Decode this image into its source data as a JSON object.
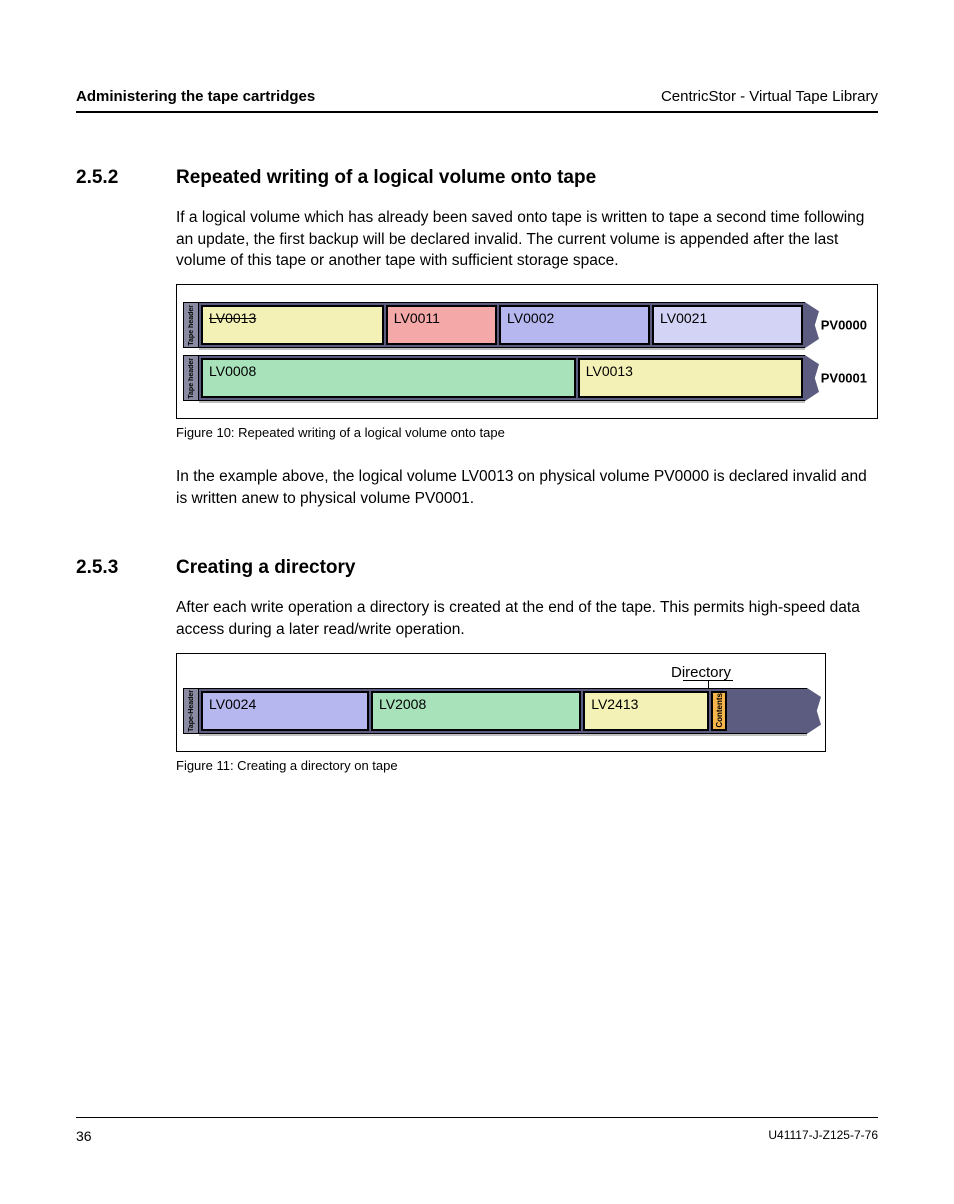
{
  "header": {
    "left": "Administering the tape cartridges",
    "right": "CentricStor - Virtual Tape Library"
  },
  "section252": {
    "num": "2.5.2",
    "title": "Repeated writing of a logical volume onto tape",
    "para1": "If a logical volume which has already been saved onto tape is written to tape a second time following an update, the first backup will be declared invalid. The current volume is appended after the last volume of this tape or another tape with sufficient storage space.",
    "fig": {
      "tape_header_label": "Tape header",
      "rows": [
        {
          "pv": "PV0000",
          "vols": [
            {
              "label": "LV0013",
              "color": "yellow",
              "strike": true,
              "flex": 2.1
            },
            {
              "label": "LV0011",
              "color": "pink",
              "strike": false,
              "flex": 1.2
            },
            {
              "label": "LV0002",
              "color": "blue",
              "strike": false,
              "flex": 1.7
            },
            {
              "label": "LV0021",
              "color": "light",
              "strike": false,
              "flex": 1.7
            }
          ]
        },
        {
          "pv": "PV0001",
          "vols": [
            {
              "label": "LV0008",
              "color": "green",
              "strike": false,
              "flex": 2.4
            },
            {
              "label": "LV0013",
              "color": "yellow",
              "strike": false,
              "flex": 1.4
            }
          ]
        }
      ],
      "caption": "Figure 10: Repeated writing of a logical volume onto tape"
    },
    "para2": "In the example above, the logical volume LV0013 on physical volume PV0000 is declared invalid and is written anew to physical volume PV0001."
  },
  "section253": {
    "num": "2.5.3",
    "title": "Creating a directory",
    "para1": "After each write operation a directory is created at the end of the tape. This permits high-speed data access during a later read/write operation.",
    "fig": {
      "top_label": "Directory",
      "tape_header_label": "Tape-Header",
      "contents_label": "Contents",
      "vols": [
        {
          "label": "LV0024",
          "color": "blue",
          "flex": 1.8
        },
        {
          "label": "LV2008",
          "color": "green",
          "flex": 2.3
        },
        {
          "label": "LV2413",
          "color": "yellow",
          "flex": 1.3
        }
      ],
      "caption": "Figure 11: Creating a directory on tape"
    }
  },
  "footer": {
    "page": "36",
    "docid": "U41117-J-Z125-7-76"
  }
}
